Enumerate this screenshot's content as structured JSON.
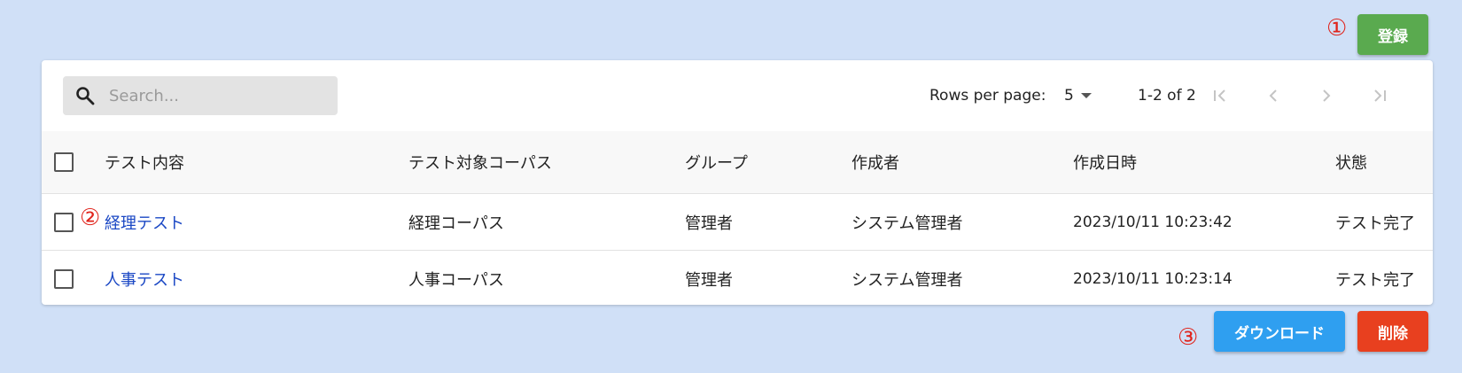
{
  "actions": {
    "register_label": "登録",
    "download_label": "ダウンロード",
    "delete_label": "削除"
  },
  "markers": {
    "m1": "①",
    "m2": "②",
    "m3": "③"
  },
  "colors": {
    "register": "#5aaa4f",
    "download": "#2f9ff0",
    "delete": "#e8401f",
    "link": "#1a47c4",
    "marker": "#e0241c",
    "background": "#d0e0f7"
  },
  "toolbar": {
    "search_placeholder": "Search...",
    "search_value": "",
    "search_icon": "search-icon",
    "rows_per_page_label": "Rows per page:",
    "rows_per_page_value": "5",
    "page_info": "1-2 of 2"
  },
  "table": {
    "headers": [
      "テスト内容",
      "テスト対象コーパス",
      "グループ",
      "作成者",
      "作成日時",
      "状態"
    ],
    "rows": [
      {
        "title": "経理テスト",
        "corpus": "経理コーパス",
        "group": "管理者",
        "author": "システム管理者",
        "created_at": "2023/10/11 10:23:42",
        "status": "テスト完了"
      },
      {
        "title": "人事テスト",
        "corpus": "人事コーパス",
        "group": "管理者",
        "author": "システム管理者",
        "created_at": "2023/10/11 10:23:14",
        "status": "テスト完了"
      }
    ]
  }
}
